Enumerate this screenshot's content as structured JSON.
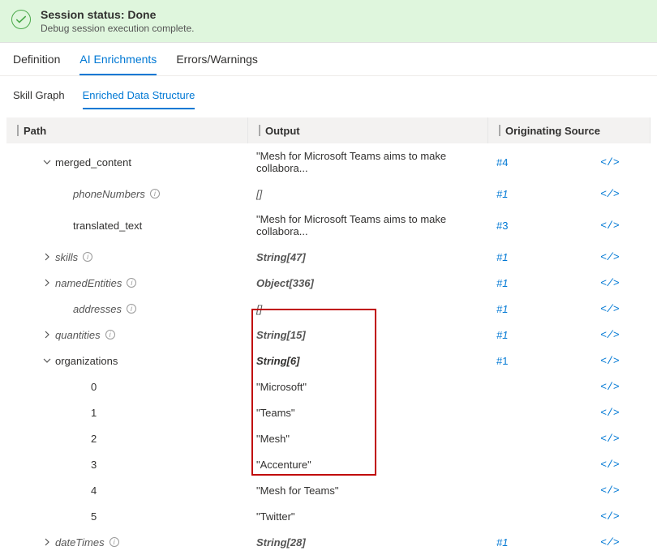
{
  "status": {
    "title": "Session status: Done",
    "subtitle": "Debug session execution complete."
  },
  "main_tabs": [
    "Definition",
    "AI Enrichments",
    "Errors/Warnings"
  ],
  "main_tab_active": 1,
  "sub_tabs": [
    "Skill Graph",
    "Enriched Data Structure"
  ],
  "sub_tab_active": 1,
  "headers": {
    "path": "Path",
    "output": "Output",
    "source": "Originating Source"
  },
  "rows": [
    {
      "path": "merged_content",
      "indent": 1,
      "caret": "down",
      "italic": false,
      "info": false,
      "output": "\"Mesh for Microsoft Teams aims to make collabora...",
      "source": "#4",
      "action": true
    },
    {
      "path": "phoneNumbers",
      "indent": 2,
      "caret": null,
      "italic": true,
      "info": true,
      "output": "[]",
      "source": "#1",
      "action": true
    },
    {
      "path": "translated_text",
      "indent": 2,
      "caret": null,
      "italic": false,
      "info": false,
      "output": "\"Mesh for Microsoft Teams aims to make collabora...",
      "source": "#3",
      "action": true
    },
    {
      "path": "skills",
      "indent": 1,
      "caret": "right",
      "italic": true,
      "info": true,
      "output": "String[47]",
      "output_em": true,
      "source": "#1",
      "action": true
    },
    {
      "path": "namedEntities",
      "indent": 1,
      "caret": "right",
      "italic": true,
      "info": true,
      "output": "Object[336]",
      "output_em": true,
      "source": "#1",
      "action": true
    },
    {
      "path": "addresses",
      "indent": 2,
      "caret": null,
      "italic": true,
      "info": true,
      "output": "[]",
      "source": "#1",
      "action": true
    },
    {
      "path": "quantities",
      "indent": 1,
      "caret": "right",
      "italic": true,
      "info": true,
      "output": "String[15]",
      "output_em": true,
      "source": "#1",
      "action": true
    },
    {
      "path": "organizations",
      "indent": 1,
      "caret": "down",
      "italic": false,
      "info": false,
      "output": "String[6]",
      "output_em": true,
      "source": "#1",
      "action": true
    },
    {
      "path": "0",
      "indent": 3,
      "caret": null,
      "italic": false,
      "info": false,
      "output": "\"Microsoft\"",
      "source": "",
      "action": true
    },
    {
      "path": "1",
      "indent": 3,
      "caret": null,
      "italic": false,
      "info": false,
      "output": "\"Teams\"",
      "source": "",
      "action": true
    },
    {
      "path": "2",
      "indent": 3,
      "caret": null,
      "italic": false,
      "info": false,
      "output": "\"Mesh\"",
      "source": "",
      "action": true
    },
    {
      "path": "3",
      "indent": 3,
      "caret": null,
      "italic": false,
      "info": false,
      "output": "\"Accenture\"",
      "source": "",
      "action": true
    },
    {
      "path": "4",
      "indent": 3,
      "caret": null,
      "italic": false,
      "info": false,
      "output": "\"Mesh for Teams\"",
      "source": "",
      "action": true
    },
    {
      "path": "5",
      "indent": 3,
      "caret": null,
      "italic": false,
      "info": false,
      "output": "\"Twitter\"",
      "source": "",
      "action": true
    },
    {
      "path": "dateTimes",
      "indent": 1,
      "caret": "right",
      "italic": true,
      "info": true,
      "output": "String[28]",
      "output_em": true,
      "source": "#1",
      "action": true
    }
  ]
}
